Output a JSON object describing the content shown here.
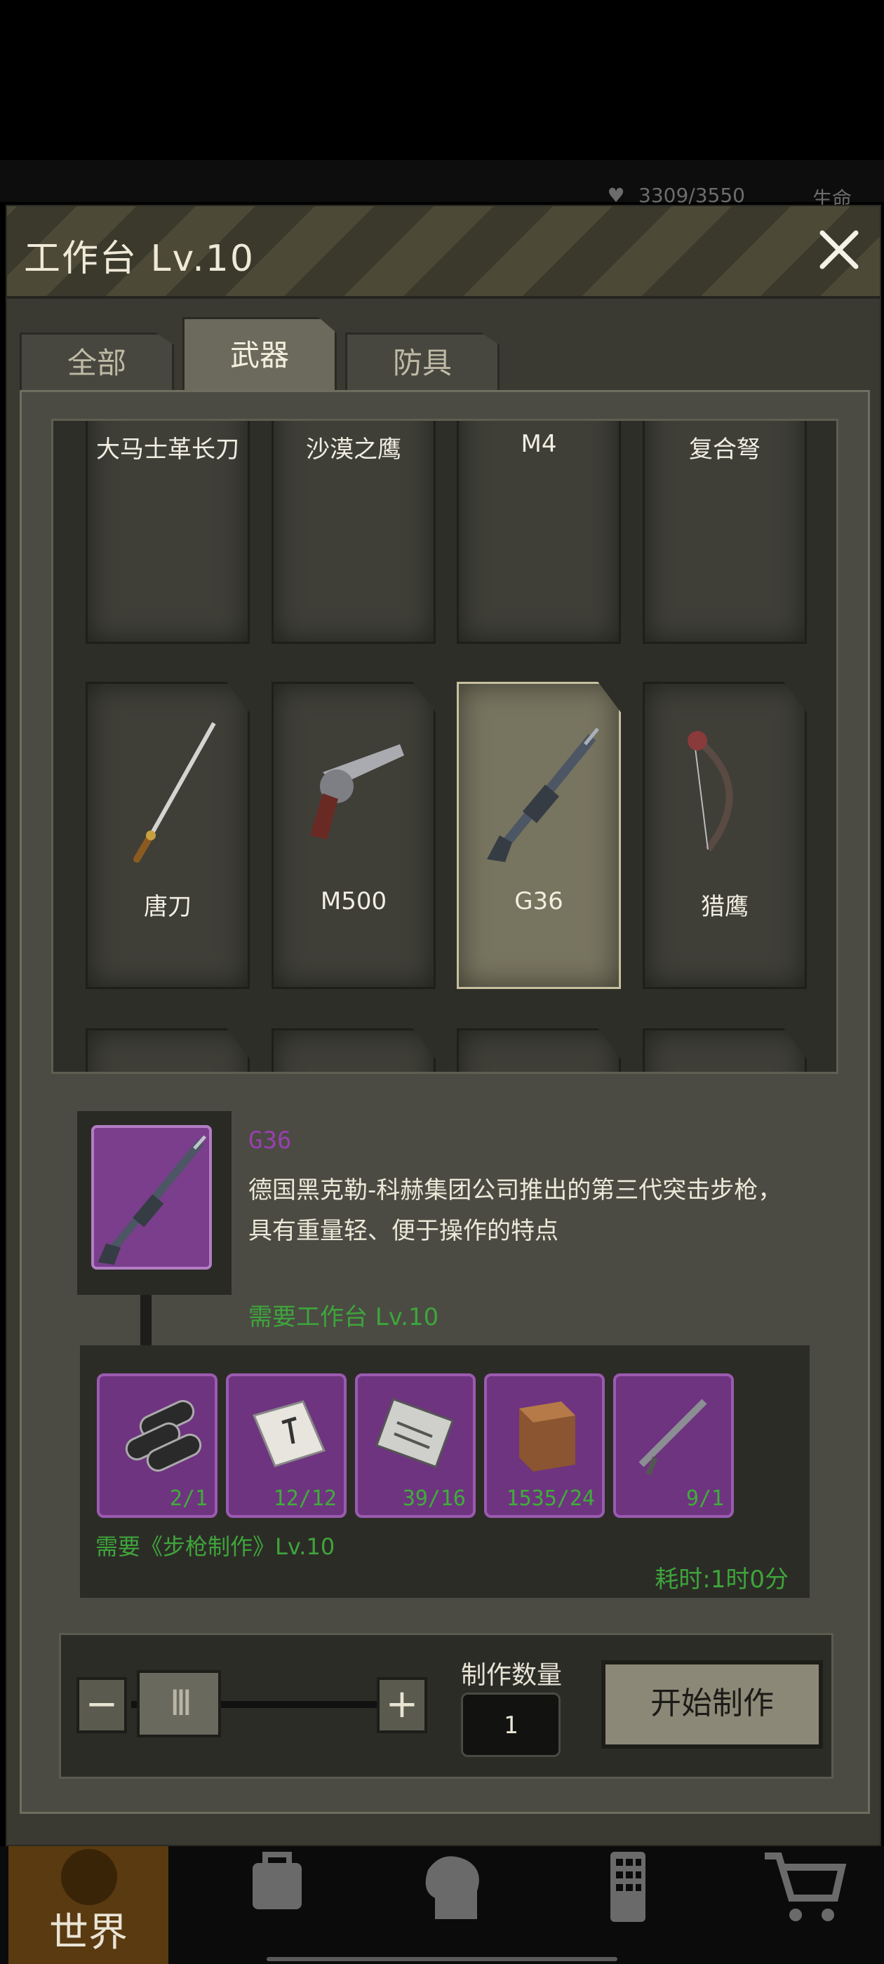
{
  "status": {
    "hp": "3309/3550",
    "life_label": "生命"
  },
  "panel": {
    "title": "工作台 Lv.10",
    "tabs": [
      {
        "label": "全部"
      },
      {
        "label": "武器"
      },
      {
        "label": "防具"
      }
    ],
    "active_tab": "武器"
  },
  "grid": {
    "row1": [
      "大马士革长刀",
      "沙漠之鹰",
      "M4",
      "复合弩"
    ],
    "row2": [
      "唐刀",
      "M500",
      "G36",
      "猎鹰"
    ],
    "selected": "G36"
  },
  "detail": {
    "name": "G36",
    "description": "德国黑克勒-科赫集团公司推出的第三代突击步枪，具有重量轻、便于操作的特点",
    "requirement": "需要工作台 Lv.10",
    "icon": "rifle-icon"
  },
  "materials": {
    "items": [
      {
        "icon": "pipes-icon",
        "count": "2/1"
      },
      {
        "icon": "tile-icon",
        "count": "12/12"
      },
      {
        "icon": "mechanism-icon",
        "count": "39/16"
      },
      {
        "icon": "wood-block-icon",
        "count": "1535/24"
      },
      {
        "icon": "gun-part-icon",
        "count": "9/1"
      }
    ],
    "skill_requirement": "需要《步枪制作》Lv.10",
    "time": "耗时:1时0分"
  },
  "controls": {
    "minus": "−",
    "plus": "+",
    "slider_handle": "III",
    "quantity_label": "制作数量",
    "quantity": "1",
    "start_label": "开始制作"
  },
  "bottom_nav": {
    "world_label": "世界"
  },
  "colors": {
    "rare_purple": "#6e3480",
    "requirement_green": "#3ea53b",
    "item_name_purple": "#9a3fb0"
  }
}
